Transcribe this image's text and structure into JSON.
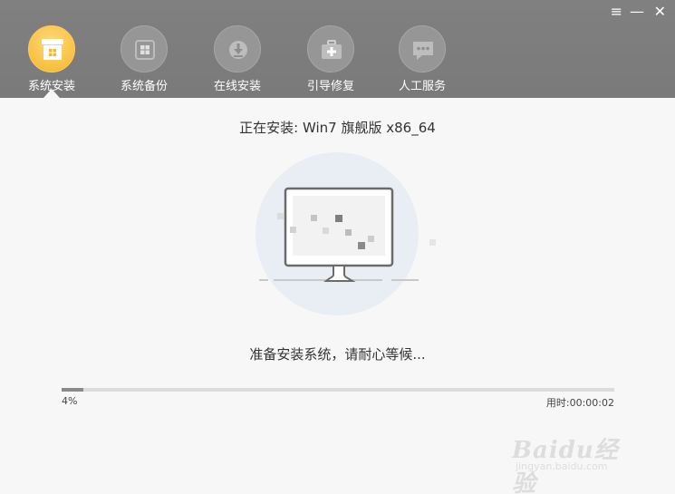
{
  "header": {
    "nav": [
      {
        "label": "系统安装",
        "icon": "system-install-icon",
        "active": true
      },
      {
        "label": "系统备份",
        "icon": "windows-icon",
        "active": false
      },
      {
        "label": "在线安装",
        "icon": "download-icon",
        "active": false
      },
      {
        "label": "引导修复",
        "icon": "medkit-icon",
        "active": false
      },
      {
        "label": "人工服务",
        "icon": "chat-icon",
        "active": false
      }
    ],
    "window_controls": {
      "menu": "≡",
      "minimize": "—",
      "close": "✕"
    }
  },
  "main": {
    "title": "正在安装: Win7 旗舰版 x86_64",
    "status": "准备安装系统，请耐心等候...",
    "progress_text": "4%",
    "progress_value": 0.04,
    "elapsed": "用时:00:00:02"
  },
  "watermark": {
    "brand": "Baidu经验",
    "url": "jingyan.baidu.com"
  },
  "colors": {
    "accent": "#f4b62b",
    "header_bg": "#7d7d7d",
    "progress_fill": "#8a8a8a"
  }
}
